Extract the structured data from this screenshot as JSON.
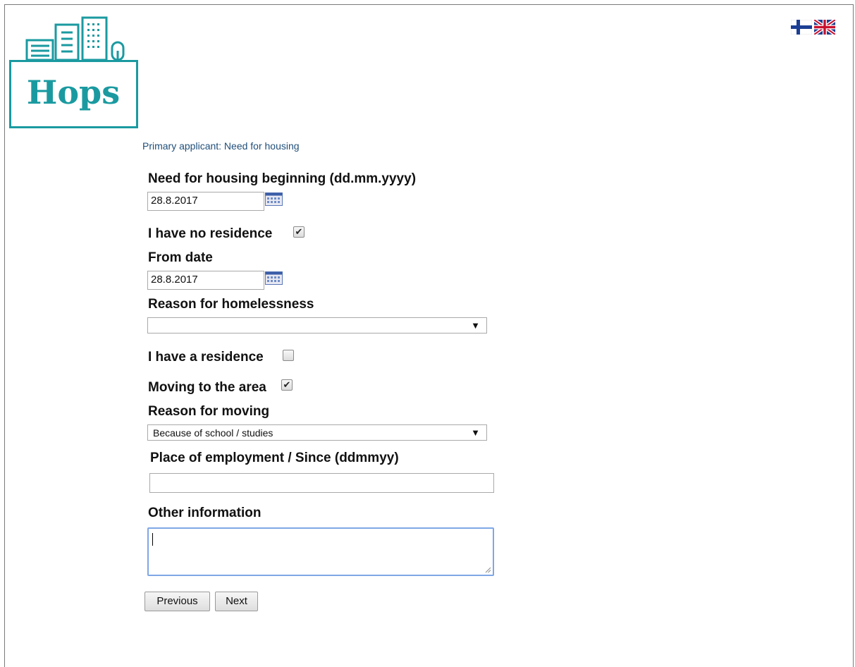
{
  "logo": {
    "text": "Hops"
  },
  "language_flags": [
    {
      "icon": "finnish-flag-icon"
    },
    {
      "icon": "uk-flag-icon"
    }
  ],
  "page_heading": "Primary applicant: Need for housing",
  "form": {
    "need_beginning_label": "Need for housing beginning (dd.mm.yyyy)",
    "need_beginning_value": "28.8.2017",
    "no_residence_label": "I have no residence",
    "no_residence_checked": true,
    "from_date_label": "From date",
    "from_date_value": "28.8.2017",
    "homeless_reason_label": "Reason for homelessness",
    "homeless_reason_value": "",
    "has_residence_label": "I have a residence",
    "has_residence_checked": false,
    "moving_label": "Moving to the area",
    "moving_checked": true,
    "moving_reason_label": "Reason for moving",
    "moving_reason_value": "Because of school / studies",
    "employment_label": "Place of employment / Since (ddmmyy)",
    "employment_value": "",
    "other_info_label": "Other information",
    "other_info_value": ""
  },
  "buttons": {
    "previous": "Previous",
    "next": "Next"
  },
  "colors": {
    "brand": "#1a9aa0",
    "heading_link": "#1f4e79",
    "focus_border": "#7fa7e6"
  },
  "icons": {
    "calendar": "calendar-icon",
    "dropdown": "dropdown-arrow-icon",
    "checkmark": "checkmark-icon"
  }
}
